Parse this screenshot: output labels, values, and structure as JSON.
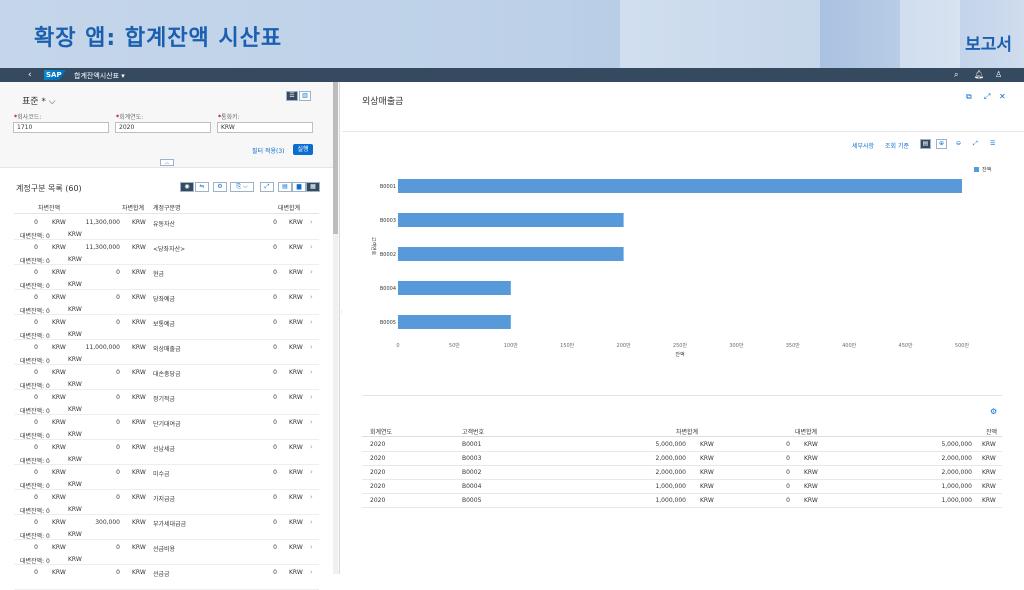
{
  "banner": {
    "title": "확장 앱: 합계잔액 시산표",
    "report": "보고서"
  },
  "shell": {
    "back": "‹",
    "logo": "SAP",
    "app_title": "합계잔액시산표 ▾",
    "icons": [
      "search-icon",
      "bell-icon",
      "user-icon"
    ]
  },
  "filter": {
    "variant": "표준 * ⌵",
    "fields": [
      {
        "label": "회사코드:",
        "value": "1710"
      },
      {
        "label": "회계연도:",
        "value": "2020"
      },
      {
        "label": "통화키:",
        "value": "KRW"
      }
    ],
    "filter_info": "필터 적용(3)",
    "go": "실행",
    "collapse": "︿"
  },
  "list": {
    "title": "계정구분 목록 (60)",
    "columns": [
      "차변잔액",
      "차변합계",
      "계정구분명",
      "대변합계"
    ],
    "rows": [
      {
        "c1": "0",
        "c2": "KRW",
        "c3": "11,300,000",
        "c4": "KRW",
        "c5": "유동자산",
        "c6": "0",
        "c7": "KRW",
        "l2": "대변잔액: 0",
        "l2c": "KRW"
      },
      {
        "c1": "0",
        "c2": "KRW",
        "c3": "11,300,000",
        "c4": "KRW",
        "c5": "<당좌자산>",
        "c6": "0",
        "c7": "KRW",
        "l2": "대변잔액: 0",
        "l2c": "KRW"
      },
      {
        "c1": "0",
        "c2": "KRW",
        "c3": "0",
        "c4": "KRW",
        "c5": "현금",
        "c6": "0",
        "c7": "KRW",
        "l2": "대변잔액: 0",
        "l2c": "KRW"
      },
      {
        "c1": "0",
        "c2": "KRW",
        "c3": "0",
        "c4": "KRW",
        "c5": "당좌예금",
        "c6": "0",
        "c7": "KRW",
        "l2": "대변잔액: 0",
        "l2c": "KRW"
      },
      {
        "c1": "0",
        "c2": "KRW",
        "c3": "0",
        "c4": "KRW",
        "c5": "보통예금",
        "c6": "0",
        "c7": "KRW",
        "l2": "대변잔액: 0",
        "l2c": "KRW"
      },
      {
        "c1": "0",
        "c2": "KRW",
        "c3": "11,000,000",
        "c4": "KRW",
        "c5": "외상매출금",
        "c6": "0",
        "c7": "KRW",
        "l2": "대변잔액: 0",
        "l2c": "KRW"
      },
      {
        "c1": "0",
        "c2": "KRW",
        "c3": "0",
        "c4": "KRW",
        "c5": "대손충당금",
        "c6": "0",
        "c7": "KRW",
        "l2": "대변잔액: 0",
        "l2c": "KRW"
      },
      {
        "c1": "0",
        "c2": "KRW",
        "c3": "0",
        "c4": "KRW",
        "c5": "정기적금",
        "c6": "0",
        "c7": "KRW",
        "l2": "대변잔액: 0",
        "l2c": "KRW"
      },
      {
        "c1": "0",
        "c2": "KRW",
        "c3": "0",
        "c4": "KRW",
        "c5": "단기대여금",
        "c6": "0",
        "c7": "KRW",
        "l2": "대변잔액: 0",
        "l2c": "KRW"
      },
      {
        "c1": "0",
        "c2": "KRW",
        "c3": "0",
        "c4": "KRW",
        "c5": "선납세금",
        "c6": "0",
        "c7": "KRW",
        "l2": "대변잔액: 0",
        "l2c": "KRW"
      },
      {
        "c1": "0",
        "c2": "KRW",
        "c3": "0",
        "c4": "KRW",
        "c5": "미수금",
        "c6": "0",
        "c7": "KRW",
        "l2": "대변잔액: 0",
        "l2c": "KRW"
      },
      {
        "c1": "0",
        "c2": "KRW",
        "c3": "0",
        "c4": "KRW",
        "c5": "가지급금",
        "c6": "0",
        "c7": "KRW",
        "l2": "대변잔액: 0",
        "l2c": "KRW"
      },
      {
        "c1": "0",
        "c2": "KRW",
        "c3": "300,000",
        "c4": "KRW",
        "c5": "부가세대급금",
        "c6": "0",
        "c7": "KRW",
        "l2": "대변잔액: 0",
        "l2c": "KRW"
      },
      {
        "c1": "0",
        "c2": "KRW",
        "c3": "0",
        "c4": "KRW",
        "c5": "선급비용",
        "c6": "0",
        "c7": "KRW",
        "l2": "대변잔액: 0",
        "l2c": "KRW"
      },
      {
        "c1": "0",
        "c2": "KRW",
        "c3": "0",
        "c4": "KRW",
        "c5": "선급금",
        "c6": "0",
        "c7": "KRW",
        "l2": "",
        "l2c": ""
      }
    ]
  },
  "chart_panel": {
    "title": "외상매출금",
    "toolbar": {
      "details": "세부사항",
      "view_by": "조회 기준"
    }
  },
  "chart_data": {
    "type": "bar",
    "orientation": "horizontal",
    "categories": [
      "B0001",
      "B0003",
      "B0002",
      "B0004",
      "B0005"
    ],
    "series": [
      {
        "name": "잔액",
        "values": [
          5000000,
          2000000,
          2000000,
          1000000,
          1000000
        ]
      }
    ],
    "x_ticks": [
      "0",
      "50만",
      "100만",
      "150만",
      "200만",
      "250만",
      "300만",
      "350만",
      "400만",
      "450만",
      "500만"
    ],
    "xlim": [
      0,
      5000000
    ],
    "xlabel": "잔액",
    "ylabel": "고객번호",
    "legend": "top-right",
    "color": "#5899da"
  },
  "table": {
    "columns": [
      "회계연도",
      "고객번호",
      "차변합계",
      "대변합계",
      "잔액"
    ],
    "rows": [
      {
        "year": "2020",
        "cust": "B0001",
        "debit": "5,000,000",
        "dc": "KRW",
        "credit": "0",
        "cc": "KRW",
        "bal": "5,000,000",
        "bc": "KRW"
      },
      {
        "year": "2020",
        "cust": "B0003",
        "debit": "2,000,000",
        "dc": "KRW",
        "credit": "0",
        "cc": "KRW",
        "bal": "2,000,000",
        "bc": "KRW"
      },
      {
        "year": "2020",
        "cust": "B0002",
        "debit": "2,000,000",
        "dc": "KRW",
        "credit": "0",
        "cc": "KRW",
        "bal": "2,000,000",
        "bc": "KRW"
      },
      {
        "year": "2020",
        "cust": "B0004",
        "debit": "1,000,000",
        "dc": "KRW",
        "credit": "0",
        "cc": "KRW",
        "bal": "1,000,000",
        "bc": "KRW"
      },
      {
        "year": "2020",
        "cust": "B0005",
        "debit": "1,000,000",
        "dc": "KRW",
        "credit": "0",
        "cc": "KRW",
        "bal": "1,000,000",
        "bc": "KRW"
      }
    ]
  }
}
